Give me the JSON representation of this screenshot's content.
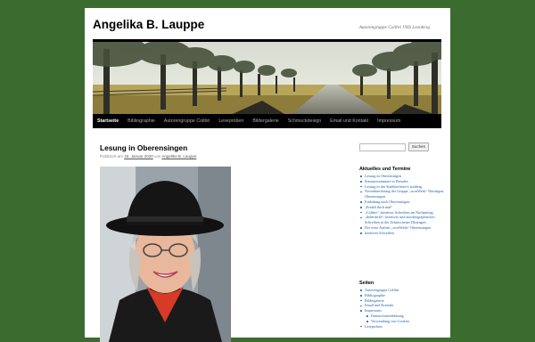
{
  "site": {
    "title": "Angelika B. Lauppe",
    "description": "Autorengruppe Colibri VHS Leonberg"
  },
  "nav": {
    "items": [
      "Startseite",
      "Bibliographie",
      "Autorengruppe Colibri",
      "Leseproben",
      "Bildergalerie",
      "Schmuckdesign",
      "Email und Kontakt",
      "Impressum"
    ],
    "active_index": 0
  },
  "post": {
    "title": "Lesung in Oberensingen",
    "meta_prefix": "Publiziert am",
    "date": "16. Januar 2020",
    "meta_by": "von",
    "author": "Angelika B. Lauppe"
  },
  "search": {
    "placeholder": "",
    "button_label": "Suchen"
  },
  "sidebar": {
    "recent": {
      "title": "Aktuelles und Termine",
      "items": [
        "Lesung in Oberensingen",
        "Sommerseminare in Dresden",
        "Lesung in der Stadtbücherei Leonberg",
        "Novemberlesung der Gruppe „wortWerk“ Nürtingen, Oberensingen",
        "Einladung nach Oberensingen",
        "„Erzähl doch mal“",
        "„Colibri“, kreatives Schreiben im Nachmittag",
        "„Inderdicht“, kreatives und autobiographisches Schreiben in der Zehntscheuer Ditzingen",
        "Der erste Auftritt „wortWerk“ Oberensingen",
        "kreatives Schreiben"
      ]
    },
    "pages": {
      "title": "Seiten",
      "items": [
        {
          "label": "Autorengruppe Colibri",
          "level": 1
        },
        {
          "label": "Bibliographie",
          "level": 1
        },
        {
          "label": "Bildergalerie",
          "level": 1
        },
        {
          "label": "Email und Kontakt",
          "level": 1
        },
        {
          "label": "Impressum",
          "level": 1
        },
        {
          "label": "Datenschutzerklärung",
          "level": 2
        },
        {
          "label": "Verwendung von Cookies",
          "level": 2
        },
        {
          "label": "Leseproben",
          "level": 1
        }
      ]
    }
  },
  "colors": {
    "background": "#3c6b30",
    "link": "#2563a8",
    "nav_bar": "#000000"
  }
}
